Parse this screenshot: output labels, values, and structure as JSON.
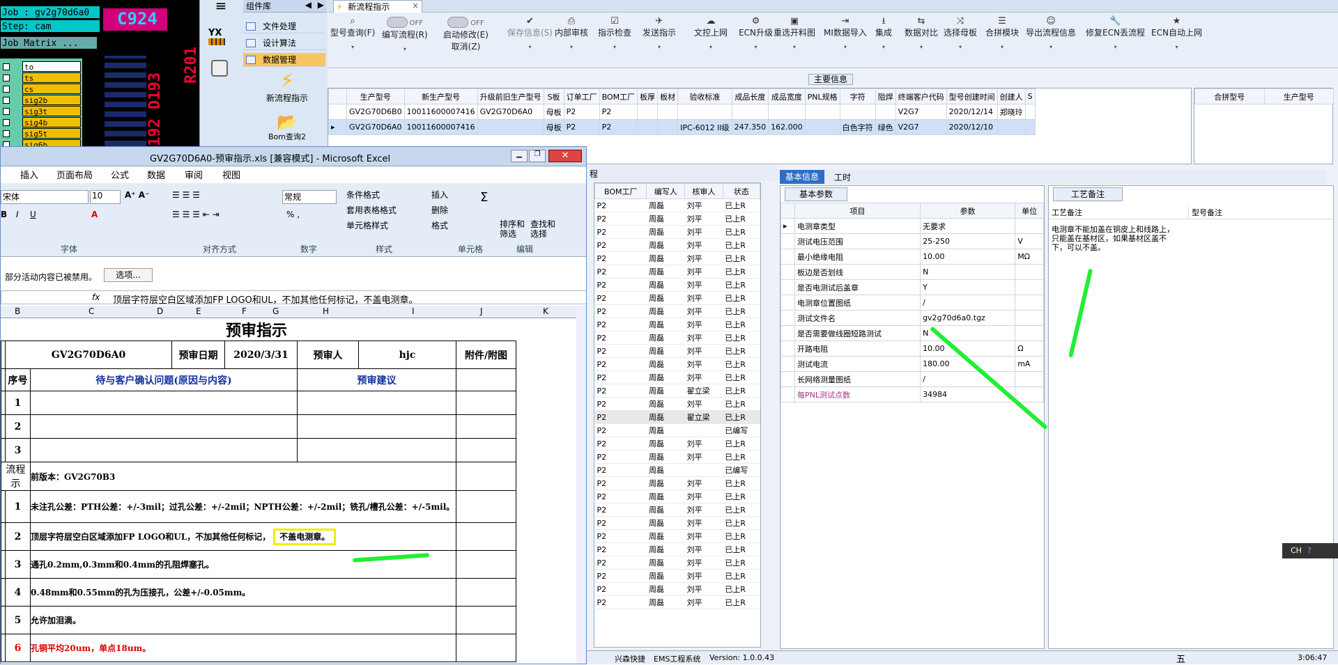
{
  "cam": {
    "job": "Job : gv2g70d6a0",
    "step": "Step: cam",
    "matrix": "Job Matrix ...",
    "layers": [
      "to",
      "ts",
      "cs",
      "sig2b",
      "sig3t",
      "sig4b",
      "sig5t",
      "sig6b"
    ],
    "overlay1": "C924",
    "overlay2": "R201",
    "overlay3": "192 D193"
  },
  "nav": {
    "header": "组件库",
    "items": [
      "文件处理",
      "设计算法",
      "数据管理"
    ],
    "yx_label": "YX",
    "feature1": "新流程指示",
    "feature2": "Bom查询2"
  },
  "tab": {
    "title": "新流程指示",
    "close": "×"
  },
  "toolbar": [
    {
      "label": "型号查询(F)",
      "icon": "search-icon"
    },
    {
      "label": "编写流程(R)",
      "icon": "toggle"
    },
    {
      "label": "启动修改(E)",
      "icon": "toggle"
    },
    {
      "label": "保存信息(S)",
      "icon": "check-icon"
    },
    {
      "label": "内部审核",
      "icon": "print-icon"
    },
    {
      "label": "指示检查",
      "icon": "checkbox-icon"
    },
    {
      "label": "发送指示",
      "icon": "send-icon"
    },
    {
      "label": "文控上网",
      "icon": "cloud-icon"
    },
    {
      "label": "ECN升级",
      "icon": "ecn-icon"
    },
    {
      "label": "重选开料图",
      "icon": "image-icon"
    },
    {
      "label": "MI数据导入",
      "icon": "import-icon"
    },
    {
      "label": "集成",
      "icon": "download-icon"
    },
    {
      "label": "数据对比",
      "icon": "compare-icon"
    },
    {
      "label": "选择母板",
      "icon": "shuffle-icon"
    },
    {
      "label": "合拼模块",
      "icon": "list-icon"
    },
    {
      "label": "导出流程信息",
      "icon": "smile-icon"
    },
    {
      "label": "修复ECN丢流程",
      "icon": "wrench-icon"
    },
    {
      "label": "ECN自动上网",
      "icon": "star-icon"
    }
  ],
  "toolbar_toggle_off": "OFF",
  "toolbar_cancel": "取消(Z)",
  "main_info": {
    "title": "主要信息",
    "columns": [
      "生产型号",
      "新生产型号",
      "升级前旧生产型号",
      "S板",
      "订单工厂",
      "BOM工厂",
      "板厚",
      "板材",
      "验收标准",
      "成品长度",
      "成品宽度",
      "PNL规格",
      "字符",
      "阻焊",
      "终端客户代码",
      "型号创建时间",
      "创建人",
      "S"
    ],
    "rows": [
      [
        "GV2G70D6B0",
        "10011600007416",
        "GV2G70D6A0",
        "母板",
        "P2",
        "P2",
        "",
        "",
        "",
        "",
        "",
        "",
        "",
        "",
        "V2G7",
        "2020/12/14",
        "郑晓玲",
        ""
      ],
      [
        "GV2G70D6A0",
        "10011600007416",
        "",
        "母板",
        "P2",
        "P2",
        "",
        "",
        "IPC-6012 II级",
        "247.350",
        "162.000",
        "",
        "白色字符",
        "绿色",
        "V2G7",
        "2020/12/10",
        "",
        ""
      ]
    ],
    "right_columns": [
      "合拼型号",
      "生产型号"
    ]
  },
  "right_list": {
    "process_tab": "程",
    "columns": [
      "BOM工厂",
      "编写人",
      "核审人",
      "状态"
    ],
    "rows": [
      [
        "P2",
        "周磊",
        "刘平",
        "已上R"
      ],
      [
        "P2",
        "周磊",
        "刘平",
        "已上R"
      ],
      [
        "P2",
        "周磊",
        "刘平",
        "已上R"
      ],
      [
        "P2",
        "周磊",
        "刘平",
        "已上R"
      ],
      [
        "P2",
        "周磊",
        "刘平",
        "已上R"
      ],
      [
        "P2",
        "周磊",
        "刘平",
        "已上R"
      ],
      [
        "P2",
        "周磊",
        "刘平",
        "已上R"
      ],
      [
        "P2",
        "周磊",
        "刘平",
        "已上R"
      ],
      [
        "P2",
        "周磊",
        "刘平",
        "已上R"
      ],
      [
        "P2",
        "周磊",
        "刘平",
        "已上R"
      ],
      [
        "P2",
        "周磊",
        "刘平",
        "已上R"
      ],
      [
        "P2",
        "周磊",
        "刘平",
        "已上R"
      ],
      [
        "P2",
        "周磊",
        "刘平",
        "已上R"
      ],
      [
        "P2",
        "周磊",
        "刘平",
        "已上R"
      ],
      [
        "P2",
        "周磊",
        "翟立梁",
        "已上R"
      ],
      [
        "P2",
        "周磊",
        "刘平",
        "已上R"
      ],
      [
        "P2",
        "周磊",
        "翟立梁",
        "已上R"
      ],
      [
        "P2",
        "周磊",
        "",
        "已编写"
      ],
      [
        "P2",
        "周磊",
        "刘平",
        "已上R"
      ],
      [
        "P2",
        "周磊",
        "刘平",
        "已上R"
      ],
      [
        "P2",
        "周磊",
        "",
        "已编写"
      ],
      [
        "P2",
        "周磊",
        "刘平",
        "已上R"
      ],
      [
        "P2",
        "周磊",
        "刘平",
        "已上R"
      ],
      [
        "P2",
        "周磊",
        "刘平",
        "已上R"
      ],
      [
        "P2",
        "周磊",
        "刘平",
        "已上R"
      ],
      [
        "P2",
        "周磊",
        "刘平",
        "已上R"
      ],
      [
        "P2",
        "周磊",
        "刘平",
        "已上R"
      ],
      [
        "P2",
        "周磊",
        "刘平",
        "已上R"
      ],
      [
        "P2",
        "周磊",
        "刘平",
        "已上R"
      ],
      [
        "P2",
        "周磊",
        "刘平",
        "已上R"
      ],
      [
        "P2",
        "周磊",
        "刘平",
        "已上R"
      ]
    ]
  },
  "basic": {
    "tab_basic": "基本信息",
    "tab_time": "工时",
    "sub_tab": "基本参数",
    "columns": [
      "项目",
      "参数",
      "单位"
    ],
    "rows": [
      [
        "电测章类型",
        "无要求",
        ""
      ],
      [
        "测试电压范围",
        "25-250",
        "V"
      ],
      [
        "最小绝缘电阻",
        "10.00",
        "MΩ"
      ],
      [
        "板边是否划线",
        "N",
        ""
      ],
      [
        "是否电测试后盖章",
        "Y",
        ""
      ],
      [
        "电测章位置图纸",
        "/",
        ""
      ],
      [
        "测试文件名",
        "gv2g70d6a0.tgz",
        ""
      ],
      [
        "是否需要做线圈短路测试",
        "N",
        ""
      ],
      [
        "开路电阻",
        "10.00",
        "Ω"
      ],
      [
        "测试电流",
        "180.00",
        "mA"
      ],
      [
        "长网络测量图纸",
        "/",
        ""
      ],
      [
        "每PNL测试点数",
        "34984",
        ""
      ]
    ]
  },
  "craft": {
    "tab": "工艺备注",
    "col1": "工艺备注",
    "col2": "型号备注",
    "note": "电测章不能加盖在铜皮上和线路上，只能盖在基材区，如果基材区盖不下，可以不盖。"
  },
  "status": {
    "company": "兴森快捷",
    "system": "EMS工程系统",
    "version": "Version: 1.0.0.43",
    "time": "3:06:47",
    "ime": "五",
    "lang": "CH"
  },
  "excel": {
    "title": "GV2G70D6A0-预审指示.xls [兼容模式] - Microsoft Excel",
    "tabs": [
      "插入",
      "页面布局",
      "公式",
      "数据",
      "审阅",
      "视图"
    ],
    "font_name": "宋体",
    "font_size": "10",
    "number_format": "常规",
    "groups": [
      "字体",
      "对齐方式",
      "数字",
      "样式",
      "单元格",
      "编辑"
    ],
    "style_items": [
      "条件格式",
      "套用表格格式",
      "单元格样式"
    ],
    "cell_items": [
      "插入",
      "删除",
      "格式"
    ],
    "edit_items": [
      "排序和筛选",
      "查找和选择"
    ],
    "security": "部分活动内容已被禁用。",
    "options": "选项...",
    "formula": "顶层字符层空白区域添加FP LOGO和UL，不加其他任何标记，不盖电测章。",
    "fx": "fx",
    "col_headers": [
      "B",
      "C",
      "D",
      "E",
      "F",
      "G",
      "H",
      "I",
      "J",
      "K"
    ],
    "sheet_title": "预审指示",
    "job": "GV2G70D6A0",
    "date_label": "预审日期",
    "date": "2020/3/31",
    "reviewer_label": "预审人",
    "reviewer": "hjc",
    "attach": "附件/附图",
    "seq": "序号",
    "issue": "待与客户确认问题(原因与内容)",
    "suggestion": "预审建议",
    "flow_label": "流程示",
    "prev": "前版本：GV2G70B3",
    "items": [
      "未注孔公差：PTH公差：+/-3mil；过孔公差：+/-2mil；NPTH公差：+/-2mil；铣孔/槽孔公差：+/-5mil。",
      "顶层字符层空白区域添加FP LOGO和UL，不加其他任何标记，",
      "通孔0.2mm,0.3mm和0.4mm的孔阻焊塞孔。",
      "0.48mm和0.55mm的孔为压接孔，公差+/-0.05mm。",
      "允许加泪滴。",
      "孔铜平均20um，单点18um。"
    ],
    "highlight": "不盖电测章。"
  }
}
